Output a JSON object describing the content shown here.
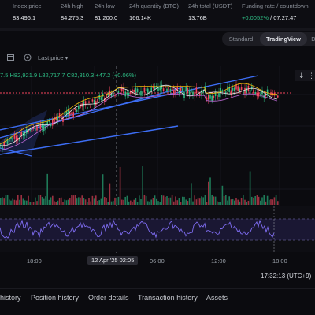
{
  "stats": [
    {
      "label": "Index price",
      "value": "83,496.1"
    },
    {
      "label": "24h high",
      "value": "84,275.3"
    },
    {
      "label": "24h low",
      "value": "81,200.0"
    },
    {
      "label": "24h quantity (BTC)",
      "value": "166.14K"
    },
    {
      "label": "24h total (USDT)",
      "value": "13.76B"
    },
    {
      "label": "Funding rate / countdown",
      "rate": "+0.0052%",
      "separator": " / ",
      "countdown": "07:27:47"
    }
  ],
  "view_toggle": {
    "standard": "Standard",
    "tradingview": "TradingView",
    "active": "TradingView"
  },
  "toolbar": {
    "last_price": "Last price",
    "last_price_caret": "▾"
  },
  "chart": {
    "ohlc": "7.5 H82,921.9 L82,717.7 C82,810.3 +47.2 (+0.06%)",
    "time_labels": [
      "18:00",
      "06:00",
      "12:00",
      "18:00"
    ],
    "crosshair_time": "12 Apr '25  02:05",
    "clock": "17:32:13 (UTC+9)",
    "colors": {
      "up": "#2ebd85",
      "down": "#f6465d",
      "trendline": "#3d6ef5",
      "rsi": "#7f6df2"
    }
  },
  "bottom_tabs": [
    "history",
    "Position history",
    "Order details",
    "Transaction history",
    "Assets"
  ]
}
